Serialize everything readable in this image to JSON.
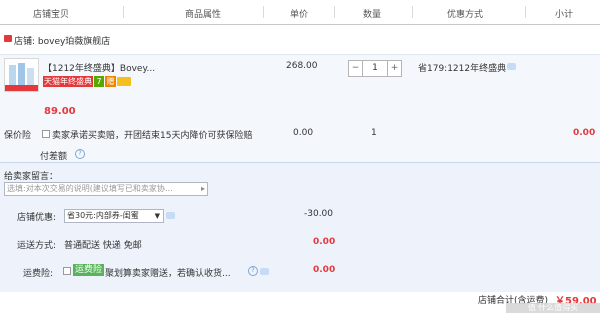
{
  "header": {
    "columns": [
      "店铺宝贝",
      "商品属性",
      "单价",
      "数量",
      "优惠方式",
      "小计"
    ]
  },
  "shop": {
    "label": "店铺: bovey珀薇旗舰店"
  },
  "item": {
    "title": "【1212年终盛典】Bovey...",
    "tags": [
      "天猫年终盛典",
      "7",
      "赠"
    ],
    "tag_colors": [
      "#e4393c",
      "#5aa700",
      "#f08300"
    ],
    "unit_price": "268.00",
    "quantity": "1",
    "discount": "省179:1212年终盛典",
    "price": "89.00",
    "insurance": {
      "label": "保价险",
      "desc_line1": "卖家承诺买卖赔，开团结束15天内降价可获保险赔",
      "desc_line2": "付差额",
      "price": "0.00",
      "qty": "1",
      "subtotal": "0.00"
    }
  },
  "buyer": {
    "message_label": "给卖家留言：",
    "message_placeholder": "选填:对本次交易的说明(建议填写已和卖家协…",
    "shop_discount_label": "店铺优惠:",
    "shop_discount_value": "省30元:内部券-闺蜜",
    "shop_discount_amount": "-30.00",
    "shipping_label": "运送方式:",
    "shipping_value": "普通配送 快递 免邮",
    "shipping_amount": "0.00",
    "freight_ins_label": "运费险:",
    "freight_ins_badge": "运费险",
    "freight_ins_desc": "聚划算卖家赠送，若确认收货...",
    "freight_ins_amount": "0.00"
  },
  "total": {
    "label": "店铺合计(含运费)",
    "amount": "￥59.00"
  },
  "watermark": "值 什么值得买"
}
